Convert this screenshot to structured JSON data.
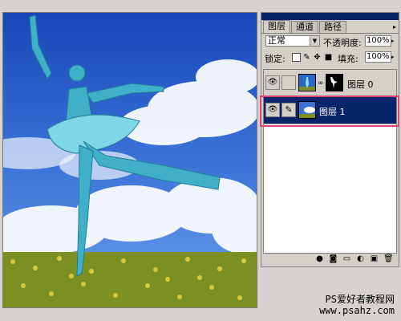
{
  "palette": {
    "tabs": [
      "图层",
      "通道",
      "路径"
    ],
    "blend_mode": "正常",
    "opacity_label": "不透明度:",
    "opacity_value": "100%",
    "lock_label": "锁定:",
    "fill_label": "填充:",
    "fill_value": "100%",
    "layers": [
      {
        "name": "图层 0",
        "visible": true,
        "selected": false
      },
      {
        "name": "图层 1",
        "visible": true,
        "selected": true
      }
    ]
  },
  "watermark": {
    "line1": "PS爱好者教程网",
    "line2": "www.psahz.com"
  },
  "colors": {
    "selected_layer": "#0a246a",
    "highlight_box": "#e33f79",
    "panel_bg": "#d4d0c8"
  }
}
